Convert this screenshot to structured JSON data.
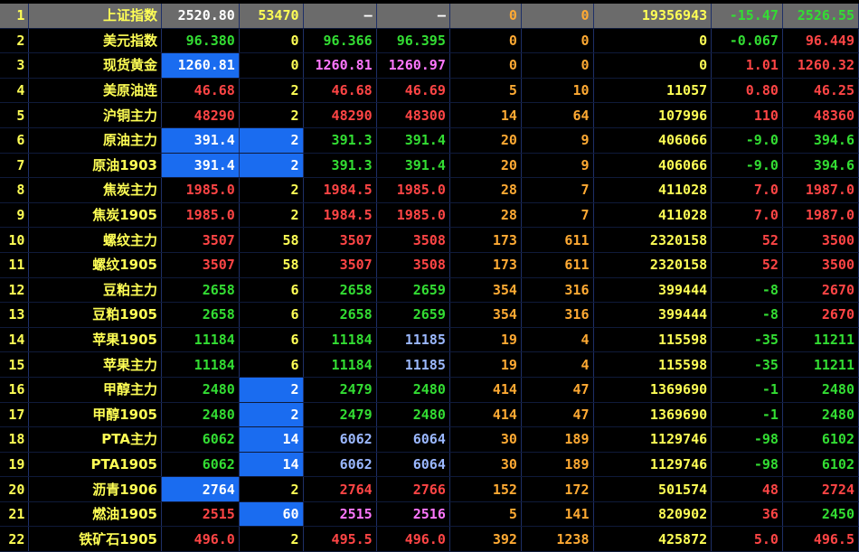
{
  "rows": [
    {
      "no": "1",
      "name": "上证指数",
      "price": "2520.80",
      "vol": "53470",
      "bid": "—",
      "ask": "—",
      "bidv": "0",
      "askv": "0",
      "oi": "19356943",
      "chg": "-15.47",
      "settle": "2526.55",
      "price_color": "eq",
      "bid_color": "eq",
      "ask_color": "eq",
      "chg_color": "dn",
      "settle_color": "dn",
      "oi_color": "or",
      "price_hl": false,
      "vol_hl": false,
      "selected": true
    },
    {
      "no": "2",
      "name": "美元指数",
      "price": "96.380",
      "vol": "0",
      "bid": "96.366",
      "ask": "96.395",
      "bidv": "0",
      "askv": "0",
      "oi": "0",
      "chg": "-0.067",
      "settle": "96.449",
      "price_color": "dn",
      "bid_color": "dn",
      "ask_color": "dn",
      "chg_color": "dn",
      "settle_color": "up",
      "oi_color": "yl",
      "price_hl": false,
      "vol_hl": false,
      "selected": false
    },
    {
      "no": "3",
      "name": "现货黄金",
      "price": "1260.81",
      "vol": "0",
      "bid": "1260.81",
      "ask": "1260.97",
      "bidv": "0",
      "askv": "0",
      "oi": "0",
      "chg": "1.01",
      "settle": "1260.32",
      "price_color": "eq",
      "bid_color": "pk",
      "ask_color": "pk",
      "chg_color": "up",
      "settle_color": "up",
      "oi_color": "yl",
      "price_hl": true,
      "vol_hl": false,
      "selected": false
    },
    {
      "no": "4",
      "name": "美原油连",
      "price": "46.68",
      "vol": "2",
      "bid": "46.68",
      "ask": "46.69",
      "bidv": "5",
      "askv": "10",
      "oi": "11057",
      "chg": "0.80",
      "settle": "46.25",
      "price_color": "up",
      "bid_color": "up",
      "ask_color": "up",
      "chg_color": "up",
      "settle_color": "up",
      "oi_color": "yl",
      "price_hl": false,
      "vol_hl": false,
      "selected": false
    },
    {
      "no": "5",
      "name": "沪铜主力",
      "price": "48290",
      "vol": "2",
      "bid": "48290",
      "ask": "48300",
      "bidv": "14",
      "askv": "64",
      "oi": "107996",
      "chg": "110",
      "settle": "48360",
      "price_color": "up",
      "bid_color": "up",
      "ask_color": "up",
      "chg_color": "up",
      "settle_color": "up",
      "oi_color": "yl",
      "price_hl": false,
      "vol_hl": false,
      "selected": false
    },
    {
      "no": "6",
      "name": "原油主力",
      "price": "391.4",
      "vol": "2",
      "bid": "391.3",
      "ask": "391.4",
      "bidv": "20",
      "askv": "9",
      "oi": "406066",
      "chg": "-9.0",
      "settle": "394.6",
      "price_color": "eq",
      "bid_color": "dn",
      "ask_color": "dn",
      "chg_color": "dn",
      "settle_color": "dn",
      "oi_color": "or",
      "price_hl": true,
      "vol_hl": true,
      "selected": false
    },
    {
      "no": "7",
      "name": "原油1903",
      "price": "391.4",
      "vol": "2",
      "bid": "391.3",
      "ask": "391.4",
      "bidv": "20",
      "askv": "9",
      "oi": "406066",
      "chg": "-9.0",
      "settle": "394.6",
      "price_color": "eq",
      "bid_color": "dn",
      "ask_color": "dn",
      "chg_color": "dn",
      "settle_color": "dn",
      "oi_color": "or",
      "price_hl": true,
      "vol_hl": true,
      "selected": false
    },
    {
      "no": "8",
      "name": "焦炭主力",
      "price": "1985.0",
      "vol": "2",
      "bid": "1984.5",
      "ask": "1985.0",
      "bidv": "28",
      "askv": "7",
      "oi": "411028",
      "chg": "7.0",
      "settle": "1987.0",
      "price_color": "up",
      "bid_color": "up",
      "ask_color": "up",
      "chg_color": "up",
      "settle_color": "up",
      "oi_color": "yl",
      "price_hl": false,
      "vol_hl": false,
      "selected": false
    },
    {
      "no": "9",
      "name": "焦炭1905",
      "price": "1985.0",
      "vol": "2",
      "bid": "1984.5",
      "ask": "1985.0",
      "bidv": "28",
      "askv": "7",
      "oi": "411028",
      "chg": "7.0",
      "settle": "1987.0",
      "price_color": "up",
      "bid_color": "up",
      "ask_color": "up",
      "chg_color": "up",
      "settle_color": "up",
      "oi_color": "yl",
      "price_hl": false,
      "vol_hl": false,
      "selected": false
    },
    {
      "no": "10",
      "name": "螺纹主力",
      "price": "3507",
      "vol": "58",
      "bid": "3507",
      "ask": "3508",
      "bidv": "173",
      "askv": "611",
      "oi": "2320158",
      "chg": "52",
      "settle": "3500",
      "price_color": "up",
      "bid_color": "up",
      "ask_color": "up",
      "chg_color": "up",
      "settle_color": "up",
      "oi_color": "yl",
      "price_hl": false,
      "vol_hl": false,
      "selected": false
    },
    {
      "no": "11",
      "name": "螺纹1905",
      "price": "3507",
      "vol": "58",
      "bid": "3507",
      "ask": "3508",
      "bidv": "173",
      "askv": "611",
      "oi": "2320158",
      "chg": "52",
      "settle": "3500",
      "price_color": "up",
      "bid_color": "up",
      "ask_color": "up",
      "chg_color": "up",
      "settle_color": "up",
      "oi_color": "yl",
      "price_hl": false,
      "vol_hl": false,
      "selected": false
    },
    {
      "no": "12",
      "name": "豆粕主力",
      "price": "2658",
      "vol": "6",
      "bid": "2658",
      "ask": "2659",
      "bidv": "354",
      "askv": "316",
      "oi": "399444",
      "chg": "-8",
      "settle": "2670",
      "price_color": "dn",
      "bid_color": "dn",
      "ask_color": "dn",
      "chg_color": "dn",
      "settle_color": "up",
      "oi_color": "yl",
      "price_hl": false,
      "vol_hl": false,
      "selected": false
    },
    {
      "no": "13",
      "name": "豆粕1905",
      "price": "2658",
      "vol": "6",
      "bid": "2658",
      "ask": "2659",
      "bidv": "354",
      "askv": "316",
      "oi": "399444",
      "chg": "-8",
      "settle": "2670",
      "price_color": "dn",
      "bid_color": "dn",
      "ask_color": "dn",
      "chg_color": "dn",
      "settle_color": "up",
      "oi_color": "yl",
      "price_hl": false,
      "vol_hl": false,
      "selected": false
    },
    {
      "no": "14",
      "name": "苹果1905",
      "price": "11184",
      "vol": "6",
      "bid": "11184",
      "ask": "11185",
      "bidv": "19",
      "askv": "4",
      "oi": "115598",
      "chg": "-35",
      "settle": "11211",
      "price_color": "dn",
      "bid_color": "dn",
      "ask_color": "bl",
      "chg_color": "dn",
      "settle_color": "dn",
      "oi_color": "yl",
      "price_hl": false,
      "vol_hl": false,
      "selected": false
    },
    {
      "no": "15",
      "name": "苹果主力",
      "price": "11184",
      "vol": "6",
      "bid": "11184",
      "ask": "11185",
      "bidv": "19",
      "askv": "4",
      "oi": "115598",
      "chg": "-35",
      "settle": "11211",
      "price_color": "dn",
      "bid_color": "dn",
      "ask_color": "bl",
      "chg_color": "dn",
      "settle_color": "dn",
      "oi_color": "yl",
      "price_hl": false,
      "vol_hl": false,
      "selected": false
    },
    {
      "no": "16",
      "name": "甲醇主力",
      "price": "2480",
      "vol": "2",
      "bid": "2479",
      "ask": "2480",
      "bidv": "414",
      "askv": "47",
      "oi": "1369690",
      "chg": "-1",
      "settle": "2480",
      "price_color": "dn",
      "bid_color": "dn",
      "ask_color": "dn",
      "chg_color": "dn",
      "settle_color": "dn",
      "oi_color": "or",
      "price_hl": false,
      "vol_hl": true,
      "selected": false
    },
    {
      "no": "17",
      "name": "甲醇1905",
      "price": "2480",
      "vol": "2",
      "bid": "2479",
      "ask": "2480",
      "bidv": "414",
      "askv": "47",
      "oi": "1369690",
      "chg": "-1",
      "settle": "2480",
      "price_color": "dn",
      "bid_color": "dn",
      "ask_color": "dn",
      "chg_color": "dn",
      "settle_color": "dn",
      "oi_color": "or",
      "price_hl": false,
      "vol_hl": true,
      "selected": false
    },
    {
      "no": "18",
      "name": "PTA主力",
      "price": "6062",
      "vol": "14",
      "bid": "6062",
      "ask": "6064",
      "bidv": "30",
      "askv": "189",
      "oi": "1129746",
      "chg": "-98",
      "settle": "6102",
      "price_color": "dn",
      "bid_color": "bl",
      "ask_color": "bl",
      "chg_color": "dn",
      "settle_color": "dn",
      "oi_color": "or",
      "price_hl": false,
      "vol_hl": true,
      "selected": false
    },
    {
      "no": "19",
      "name": "PTA1905",
      "price": "6062",
      "vol": "14",
      "bid": "6062",
      "ask": "6064",
      "bidv": "30",
      "askv": "189",
      "oi": "1129746",
      "chg": "-98",
      "settle": "6102",
      "price_color": "dn",
      "bid_color": "bl",
      "ask_color": "bl",
      "chg_color": "dn",
      "settle_color": "dn",
      "oi_color": "or",
      "price_hl": false,
      "vol_hl": true,
      "selected": false
    },
    {
      "no": "20",
      "name": "沥青1906",
      "price": "2764",
      "vol": "2",
      "bid": "2764",
      "ask": "2766",
      "bidv": "152",
      "askv": "172",
      "oi": "501574",
      "chg": "48",
      "settle": "2724",
      "price_color": "eq",
      "bid_color": "up",
      "ask_color": "up",
      "chg_color": "up",
      "settle_color": "up",
      "oi_color": "or",
      "price_hl": true,
      "vol_hl": false,
      "selected": false
    },
    {
      "no": "21",
      "name": "燃油1905",
      "price": "2515",
      "vol": "60",
      "bid": "2515",
      "ask": "2516",
      "bidv": "5",
      "askv": "141",
      "oi": "820902",
      "chg": "36",
      "settle": "2450",
      "price_color": "up",
      "bid_color": "pk",
      "ask_color": "pk",
      "chg_color": "up",
      "settle_color": "dn",
      "oi_color": "or",
      "price_hl": false,
      "vol_hl": true,
      "selected": false
    },
    {
      "no": "22",
      "name": "铁矿石1905",
      "price": "496.0",
      "vol": "2",
      "bid": "495.5",
      "ask": "496.0",
      "bidv": "392",
      "askv": "1238",
      "oi": "425872",
      "chg": "5.0",
      "settle": "496.5",
      "price_color": "up",
      "bid_color": "up",
      "ask_color": "up",
      "chg_color": "up",
      "settle_color": "up",
      "oi_color": "yl",
      "price_hl": false,
      "vol_hl": false,
      "selected": false
    }
  ]
}
